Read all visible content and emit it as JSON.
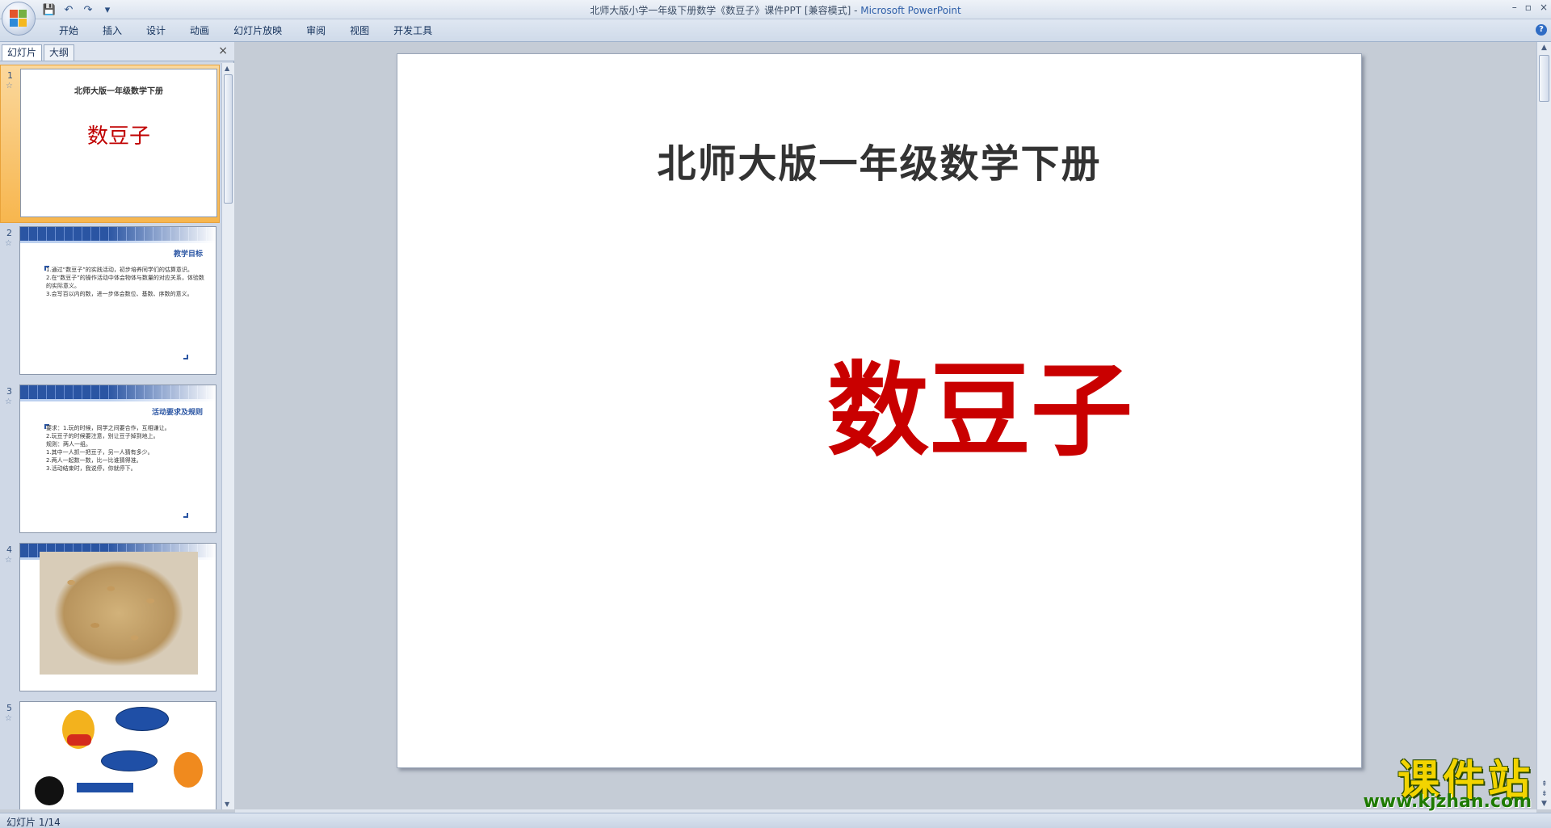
{
  "window": {
    "title": "北师大版小学一年级下册数学《数豆子》课件PPT [兼容模式] - ",
    "app_name": "Microsoft PowerPoint",
    "controls": [
      "–",
      "▫",
      "×"
    ]
  },
  "quick_access": {
    "icons": [
      "save-icon",
      "undo-icon",
      "redo-icon",
      "customize-icon"
    ],
    "glyphs": [
      "💾",
      "↶",
      "↷",
      "▾"
    ]
  },
  "ribbon": {
    "tabs": [
      "开始",
      "插入",
      "设计",
      "动画",
      "幻灯片放映",
      "审阅",
      "视图",
      "开发工具"
    ],
    "help": "?"
  },
  "panel": {
    "tabs": [
      "幻灯片",
      "大纲"
    ],
    "close": "×"
  },
  "thumbnails": [
    {
      "num": "1",
      "title": "北师大版一年级数学下册",
      "main": "数豆子"
    },
    {
      "num": "2",
      "heading": "教学目标",
      "lines": [
        "1.通过“数豆子”的实践活动，初步培养同学们的估算意识。",
        "2.在“数豆子”的操作活动中体会物体与数量的对应关系，体验数的实际意义。",
        "3.会写百以内的数，进一步体会数位、基数、序数的意义。"
      ]
    },
    {
      "num": "3",
      "heading": "活动要求及规则",
      "lines": [
        "要求：1.玩的时候，同学之间要合作，互相谦让。",
        "2.玩豆子的时候要注意，别让豆子掉到地上。",
        "规则：两人一组。",
        "1.其中一人抓一把豆子，另一人猜有多少。",
        "2.两人一起数一数，比一比谁猜得准。",
        "3.活动结束时，我说停，你就停下。"
      ]
    },
    {
      "num": "4"
    },
    {
      "num": "5"
    }
  ],
  "slide": {
    "title": "北师大版一年级数学下册",
    "main_text": "数豆子"
  },
  "status": {
    "text": "幻灯片 1/14"
  },
  "watermark": {
    "main": "课件站",
    "url": "www.kjzhan.com"
  },
  "colors": {
    "accent": "#2a55a3",
    "title_red": "#c90000",
    "selection": "#f7b64e"
  }
}
